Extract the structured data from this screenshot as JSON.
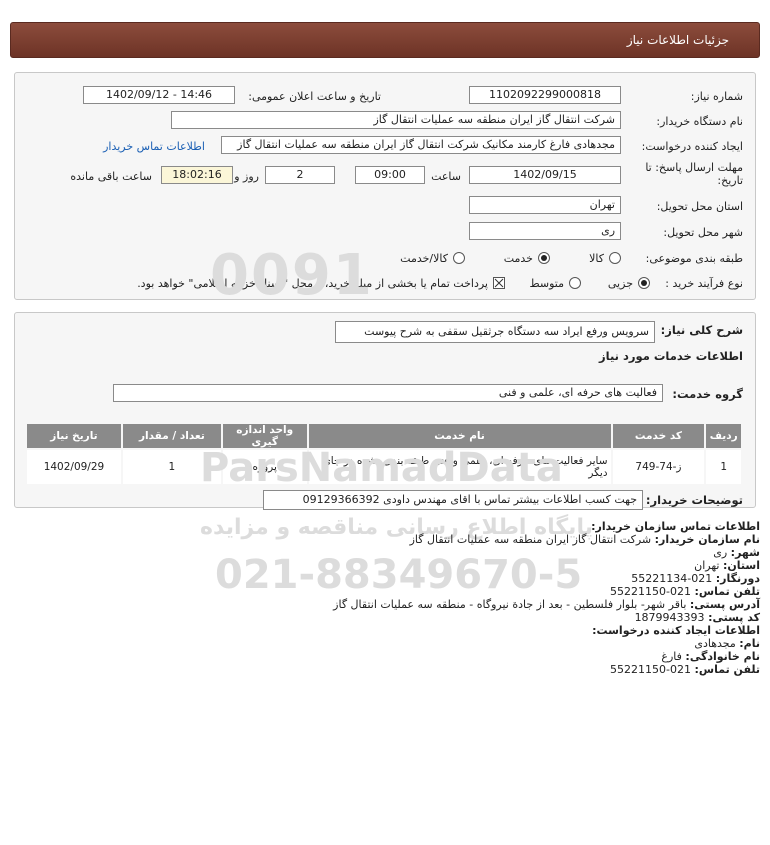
{
  "header": {
    "title": "جزئیات اطلاعات نیاز"
  },
  "form": {
    "need_number": {
      "label": "شماره نیاز:",
      "value": "1102092299000818"
    },
    "announce": {
      "label": "تاریخ و ساعت اعلان عمومی:",
      "value": "1402/09/12 - 14:46"
    },
    "buyer_org": {
      "label": "نام دستگاه خریدار:",
      "value": "شرکت انتقال گاز ایران منطقه سه عملیات انتقال گاز"
    },
    "creator": {
      "label": "ایجاد کننده درخواست:",
      "value": "مجدهادی فارغ کارمند مکانیک شرکت انتقال گاز ایران منطقه سه عملیات انتقال گاز",
      "contact_link": "اطلاعات تماس خریدار"
    },
    "deadline": {
      "label_line1": "مهلت ارسال پاسخ: تا",
      "label_line2": "تاریخ:",
      "date": "1402/09/15",
      "time_label": "ساعت",
      "time": "09:00",
      "days": "2",
      "days_label": "روز و",
      "remaining": "18:02:16",
      "remaining_label": "ساعت باقی مانده"
    },
    "province": {
      "label": "استان محل تحویل:",
      "value": "تهران"
    },
    "city": {
      "label": "شهر محل تحویل:",
      "value": "ری"
    },
    "category": {
      "label": "طبقه بندی موضوعی:",
      "options": [
        "کالا",
        "خدمت",
        "کالا/خدمت"
      ],
      "selected": "خدمت"
    },
    "process": {
      "label": "نوع فرآیند خرید :",
      "options": [
        "جزیی",
        "متوسط"
      ],
      "selected": "جزیی",
      "note": "پرداخت تمام یا بخشی از مبلغ خرید،از محل \"اسناد خزانه اسلامی\" خواهد بود."
    }
  },
  "need": {
    "summary_label": "شرح کلی نیاز:",
    "summary": "سرویس ورفع ایراد سه دستگاه جرثقیل سقفی به شرح پیوست",
    "services_title": "اطلاعات خدمات مورد نیاز",
    "group_label": "گروه خدمت:",
    "group_value": "فعالیت های حرفه ای، علمی و فنی",
    "table": {
      "headers": [
        "ردیف",
        "کد خدمت",
        "نام خدمت",
        "واحد اندازه گیری",
        "تعداد / مقدار",
        "تاریخ نیاز"
      ],
      "rows": [
        {
          "row": "1",
          "code": "ز-74-749",
          "name": "سایر فعالیت های حرفه ای، علمی و فنی طبقه بندی نشده در جای دیگر",
          "unit": "پروژه",
          "qty": "1",
          "date": "1402/09/29"
        }
      ]
    },
    "notes_label": "توضیحات خریدار:",
    "notes": "جهت کسب اطلاعات بیشتر تماس با اقای مهندس داودی 09129366392"
  },
  "contact": {
    "title": "اطلاعات تماس سازمان خریدار:",
    "org_label": "نام سازمان خریدار:",
    "org": "شرکت انتقال گاز ایران منطقه سه عملیات انتقال گاز",
    "city_label": "شهر:",
    "city": "ری",
    "province_label": "استان:",
    "province": "تهران",
    "fax_label": "دورنگار:",
    "fax": "021-55221134",
    "phone_label": "تلفن تماس:",
    "phone": "021-55221150",
    "address_label": "آدرس پستی:",
    "address": "باقر شهر- بلوار فلسطین - بعد از جادة نیروگاه - منطقه سه عملیات انتقال گاز",
    "postal_label": "کد پستی:",
    "postal": "1879943393",
    "creator_title": "اطلاعات ایجاد کننده درخواست:",
    "name_label": "نام:",
    "name": "مجدهادی",
    "family_label": "نام خانوادگی:",
    "family": "فارغ",
    "cphone_label": "تلفن تماس:",
    "cphone": "021-55221150"
  },
  "watermark": {
    "brand": "ParsNamadData",
    "tagline": "پایگاه اطلاع رسانی مناقصه و مزایده",
    "phone": "021-88349670-5"
  },
  "colors": {
    "header": "#7a3d2f",
    "link": "#1a5fb4",
    "table_header": "#8a8a8a",
    "remaining_bg": "#fbf6d8"
  }
}
